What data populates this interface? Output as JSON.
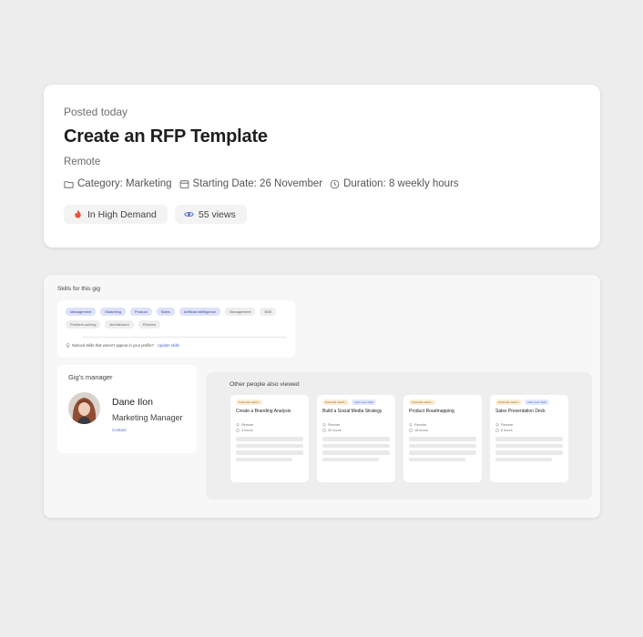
{
  "gig": {
    "posted": "Posted today",
    "title": "Create an RFP Template",
    "location": "Remote",
    "category": "Category: Marketing",
    "start_date": "Starting Date: 26 November",
    "duration": "Duration: 8 weekly hours",
    "demand": "In High Demand",
    "views": "55 views"
  },
  "skills": {
    "heading": "Skills for this gig",
    "tags": [
      {
        "label": "Management",
        "highlighted": true
      },
      {
        "label": "Marketing",
        "highlighted": true
      },
      {
        "label": "Product",
        "highlighted": true
      },
      {
        "label": "Sales",
        "highlighted": true
      },
      {
        "label": "Artificial Intelligence",
        "highlighted": true
      },
      {
        "label": "Management",
        "highlighted": false
      },
      {
        "label": "B2B",
        "highlighted": false
      },
      {
        "label": "Problem solving",
        "highlighted": false
      },
      {
        "label": "Architecture",
        "highlighted": false
      },
      {
        "label": "Finance",
        "highlighted": false
      }
    ],
    "note": "Noticed skills that weren't appear in your profile?",
    "update_link": "Update skills"
  },
  "manager": {
    "heading": "Gig's manager",
    "name": "Dane Ilon",
    "role": "Marketing Manager",
    "contact": "Contact"
  },
  "others": {
    "heading": "Other people also viewed",
    "cards": [
      {
        "match": "Potential match",
        "new_skills": "",
        "title": "Create a Branding Analysis",
        "location": "Remote",
        "duration": "4 hours"
      },
      {
        "match": "Potential match",
        "new_skills": "Gain new skills",
        "title": "Build a Social Media Strategy",
        "location": "Remote",
        "duration": "20 hours"
      },
      {
        "match": "Potential match",
        "new_skills": "",
        "title": "Product Roadmapping",
        "location": "Remote",
        "duration": "16 hours"
      },
      {
        "match": "Potential match",
        "new_skills": "Gain new skills",
        "title": "Sales Presentation Deck",
        "location": "Remote",
        "duration": "8 hours"
      }
    ]
  },
  "colors": {
    "accent": "#4e6bd6",
    "demand_icon": "#e8523b",
    "tag_highlight": "#dde2f8",
    "match_badge": "#fbeed6"
  }
}
